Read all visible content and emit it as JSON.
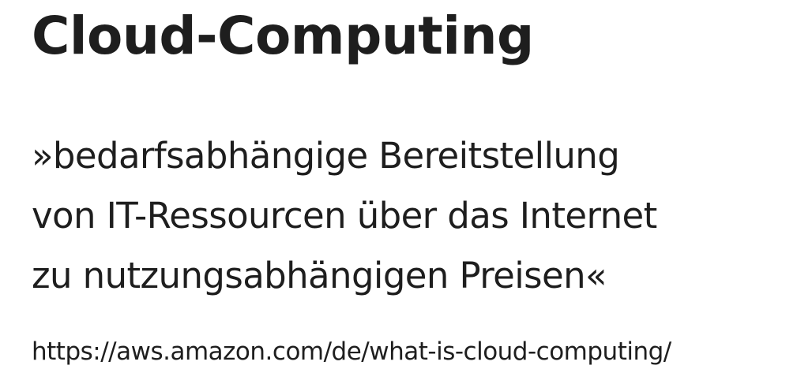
{
  "slide": {
    "title": "Cloud-Computing",
    "quote_lines": [
      "»bedarfsabhängige Bereitstellung",
      "von IT-Ressourcen über das Internet",
      "zu nutzungsabhängigen Preisen«"
    ],
    "source_url": "https://aws.amazon.com/de/what-is-cloud-computing/"
  }
}
